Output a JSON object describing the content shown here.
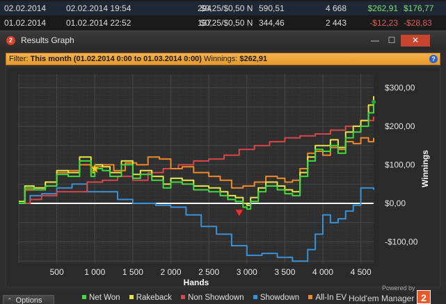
{
  "sessions": [
    {
      "date": "02.02.2014",
      "time": "02.02.2014 19:54",
      "hands": "294",
      "stakes": "$0,25/$0,50 N",
      "bb": "590,51",
      "vpip": "4 668",
      "won": "$262,91",
      "won2": "$176,77",
      "won_class": "pos"
    },
    {
      "date": "01.02.2014",
      "time": "01.02.2014 22:52",
      "hands": "137",
      "stakes": "$0,25/$0,50 N",
      "bb": "344,46",
      "vpip": "2 443",
      "won": "-$12,23",
      "won2": "-$28,83",
      "won_class": "neg"
    }
  ],
  "window": {
    "title": "Results Graph",
    "minimize": "—",
    "maximize": "☐",
    "close": "✕"
  },
  "filter": {
    "prefix": "Filter: ",
    "range": "This month (01.02.2014 0:00 to 01.03.2014 0:00)",
    "winnings_label": " Winnings: ",
    "winnings": "$262,91",
    "help": "?"
  },
  "chart_data": {
    "type": "line",
    "xlabel": "Hands",
    "ylabel": "Winnings",
    "xlim": [
      0,
      4668
    ],
    "ylim": [
      -155,
      335
    ],
    "x_ticks": [
      500,
      1000,
      1500,
      2000,
      2500,
      3000,
      3500,
      4000,
      4500
    ],
    "x_tick_labels": [
      "500",
      "1 000",
      "1 500",
      "2 000",
      "2 500",
      "3 000",
      "3 500",
      "4 000",
      "4 500"
    ],
    "y_ticks": [
      300,
      200,
      100,
      0,
      -100
    ],
    "y_tick_labels": [
      "$300,00",
      "$200,00",
      "$100,00",
      "$0,00",
      "-$100,00"
    ],
    "grid": true,
    "legend_position": "bottom",
    "series": [
      {
        "name": "Net Won",
        "color": "#3fdc3f",
        "points": [
          [
            0,
            0
          ],
          [
            80,
            40
          ],
          [
            200,
            35
          ],
          [
            350,
            45
          ],
          [
            500,
            75
          ],
          [
            650,
            70
          ],
          [
            800,
            110
          ],
          [
            950,
            70
          ],
          [
            1000,
            90
          ],
          [
            1100,
            85
          ],
          [
            1200,
            70
          ],
          [
            1350,
            100
          ],
          [
            1500,
            65
          ],
          [
            1600,
            75
          ],
          [
            1750,
            60
          ],
          [
            1900,
            40
          ],
          [
            2000,
            55
          ],
          [
            2150,
            50
          ],
          [
            2300,
            35
          ],
          [
            2500,
            30
          ],
          [
            2650,
            20
          ],
          [
            2750,
            10
          ],
          [
            2850,
            5
          ],
          [
            2950,
            -10
          ],
          [
            3000,
            -15
          ],
          [
            3050,
            5
          ],
          [
            3150,
            30
          ],
          [
            3250,
            45
          ],
          [
            3400,
            35
          ],
          [
            3500,
            25
          ],
          [
            3600,
            20
          ],
          [
            3700,
            70
          ],
          [
            3800,
            110
          ],
          [
            3900,
            140
          ],
          [
            4000,
            135
          ],
          [
            4100,
            150
          ],
          [
            4200,
            130
          ],
          [
            4300,
            170
          ],
          [
            4400,
            185
          ],
          [
            4500,
            200
          ],
          [
            4600,
            235
          ],
          [
            4668,
            263
          ]
        ]
      },
      {
        "name": "Rakeback",
        "color": "#e6e64a",
        "points": [
          [
            0,
            5
          ],
          [
            80,
            45
          ],
          [
            200,
            40
          ],
          [
            350,
            55
          ],
          [
            500,
            85
          ],
          [
            650,
            80
          ],
          [
            800,
            120
          ],
          [
            950,
            80
          ],
          [
            1000,
            100
          ],
          [
            1100,
            95
          ],
          [
            1200,
            80
          ],
          [
            1350,
            110
          ],
          [
            1500,
            75
          ],
          [
            1600,
            85
          ],
          [
            1750,
            70
          ],
          [
            1900,
            50
          ],
          [
            2000,
            65
          ],
          [
            2150,
            60
          ],
          [
            2300,
            45
          ],
          [
            2500,
            40
          ],
          [
            2650,
            30
          ],
          [
            2750,
            20
          ],
          [
            2850,
            15
          ],
          [
            2950,
            0
          ],
          [
            3000,
            -5
          ],
          [
            3050,
            15
          ],
          [
            3150,
            40
          ],
          [
            3250,
            55
          ],
          [
            3400,
            45
          ],
          [
            3500,
            35
          ],
          [
            3600,
            30
          ],
          [
            3700,
            80
          ],
          [
            3800,
            120
          ],
          [
            3900,
            150
          ],
          [
            4000,
            150
          ],
          [
            4100,
            165
          ],
          [
            4200,
            145
          ],
          [
            4300,
            185
          ],
          [
            4400,
            200
          ],
          [
            4500,
            215
          ],
          [
            4600,
            255
          ],
          [
            4668,
            278
          ]
        ]
      },
      {
        "name": "Non Showdown",
        "color": "#d8474b",
        "points": [
          [
            0,
            0
          ],
          [
            150,
            10
          ],
          [
            300,
            20
          ],
          [
            500,
            30
          ],
          [
            700,
            30
          ],
          [
            900,
            55
          ],
          [
            1100,
            60
          ],
          [
            1300,
            70
          ],
          [
            1500,
            60
          ],
          [
            1700,
            80
          ],
          [
            1900,
            90
          ],
          [
            2100,
            100
          ],
          [
            2300,
            110
          ],
          [
            2500,
            115
          ],
          [
            2700,
            125
          ],
          [
            2900,
            140
          ],
          [
            3100,
            150
          ],
          [
            3300,
            160
          ],
          [
            3500,
            170
          ],
          [
            3700,
            175
          ],
          [
            3900,
            180
          ],
          [
            4100,
            190
          ],
          [
            4300,
            200
          ],
          [
            4500,
            215
          ],
          [
            4668,
            225
          ]
        ]
      },
      {
        "name": "Showdown",
        "color": "#3a92d6",
        "points": [
          [
            0,
            0
          ],
          [
            150,
            20
          ],
          [
            300,
            25
          ],
          [
            500,
            40
          ],
          [
            700,
            50
          ],
          [
            900,
            30
          ],
          [
            1100,
            30
          ],
          [
            1300,
            10
          ],
          [
            1500,
            0
          ],
          [
            1800,
            -5
          ],
          [
            2000,
            -10
          ],
          [
            2200,
            -30
          ],
          [
            2400,
            -60
          ],
          [
            2600,
            -80
          ],
          [
            2800,
            -110
          ],
          [
            3000,
            -135
          ],
          [
            3200,
            -130
          ],
          [
            3400,
            -140
          ],
          [
            3600,
            -150
          ],
          [
            3800,
            -120
          ],
          [
            3900,
            -80
          ],
          [
            4000,
            -30
          ],
          [
            4100,
            -50
          ],
          [
            4200,
            -40
          ],
          [
            4300,
            -20
          ],
          [
            4400,
            -5
          ],
          [
            4500,
            40
          ],
          [
            4668,
            35
          ]
        ]
      },
      {
        "name": "All-In EV",
        "color": "#ef8a28",
        "points": [
          [
            0,
            0
          ],
          [
            80,
            35
          ],
          [
            200,
            40
          ],
          [
            350,
            55
          ],
          [
            500,
            80
          ],
          [
            650,
            85
          ],
          [
            800,
            100
          ],
          [
            950,
            95
          ],
          [
            1100,
            100
          ],
          [
            1250,
            85
          ],
          [
            1400,
            105
          ],
          [
            1550,
            100
          ],
          [
            1700,
            120
          ],
          [
            1850,
            115
          ],
          [
            2000,
            90
          ],
          [
            2150,
            95
          ],
          [
            2300,
            80
          ],
          [
            2500,
            70
          ],
          [
            2650,
            60
          ],
          [
            2800,
            40
          ],
          [
            2950,
            45
          ],
          [
            3100,
            55
          ],
          [
            3250,
            70
          ],
          [
            3400,
            65
          ],
          [
            3500,
            55
          ],
          [
            3600,
            60
          ],
          [
            3700,
            90
          ],
          [
            3800,
            130
          ],
          [
            3900,
            135
          ],
          [
            4000,
            125
          ],
          [
            4100,
            145
          ],
          [
            4200,
            140
          ],
          [
            4300,
            160
          ],
          [
            4400,
            155
          ],
          [
            4500,
            170
          ],
          [
            4600,
            160
          ],
          [
            4668,
            170
          ]
        ]
      }
    ],
    "markers": [
      {
        "type": "star",
        "x": 1000,
        "y": 90,
        "color": "#f5d52b"
      },
      {
        "type": "down-triangle",
        "x": 2900,
        "y": -25,
        "color": "#e0383a"
      }
    ]
  },
  "bottom": {
    "options_label": "Options",
    "options_chevron": "⌃",
    "legend": [
      {
        "label": "Net Won",
        "color": "#3fdc3f"
      },
      {
        "label": "Rakeback",
        "color": "#e6e64a"
      },
      {
        "label": "Non Showdown",
        "color": "#d8474b"
      },
      {
        "label": "Showdown",
        "color": "#3a92d6"
      },
      {
        "label": "All-In EV",
        "color": "#ef8a28"
      }
    ],
    "powered_by": "Powered by",
    "brand": "Hold'em Manager",
    "brand_badge": "2"
  }
}
